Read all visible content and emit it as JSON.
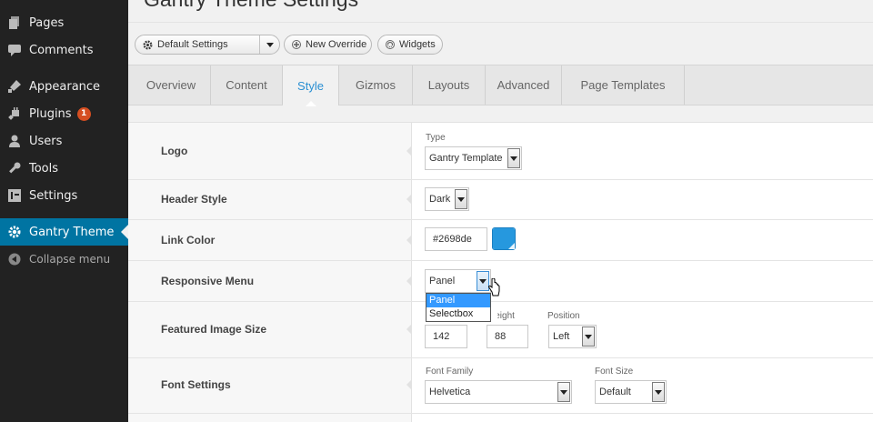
{
  "colors": {
    "sidebar_bg": "#222222",
    "active_bg": "#0074a2",
    "accent": "#2a8fd2",
    "swatch": "#2698de",
    "badge": "#d54e21"
  },
  "sidebar": {
    "items": [
      {
        "label": "Pages",
        "icon": "pages-icon"
      },
      {
        "label": "Comments",
        "icon": "comments-icon"
      },
      {
        "label": "Appearance",
        "icon": "appearance-icon"
      },
      {
        "label": "Plugins",
        "icon": "plugins-icon",
        "badge": "1"
      },
      {
        "label": "Users",
        "icon": "users-icon"
      },
      {
        "label": "Tools",
        "icon": "tools-icon"
      },
      {
        "label": "Settings",
        "icon": "settings-icon"
      },
      {
        "label": "Gantry Theme",
        "icon": "gear-icon",
        "active": true
      }
    ],
    "collapse_label": "Collapse menu"
  },
  "header": {
    "title": "Gantry Theme Settings"
  },
  "toolbar": {
    "default_label": "Default Settings",
    "override_label": "New Override",
    "widgets_label": "Widgets"
  },
  "tabs": [
    "Overview",
    "Content",
    "Style",
    "Gizmos",
    "Layouts",
    "Advanced",
    "Page Templates"
  ],
  "active_tab": "Style",
  "settings": {
    "logo": {
      "label": "Logo",
      "type_label": "Type",
      "type_value": "Gantry Template"
    },
    "header_style": {
      "label": "Header Style",
      "value": "Dark"
    },
    "link_color": {
      "label": "Link Color",
      "value": "#2698de"
    },
    "responsive_menu": {
      "label": "Responsive Menu",
      "value": "Panel",
      "options": [
        "Panel",
        "Selectbox"
      ]
    },
    "featured_image": {
      "label": "Featured Image Size",
      "height_label": "Height",
      "position_label": "Position",
      "width_value": "142",
      "height_value": "88",
      "position_value": "Left"
    },
    "font_settings": {
      "label": "Font Settings",
      "family_label": "Font Family",
      "family_value": "Helvetica",
      "size_label": "Font Size",
      "size_value": "Default"
    }
  }
}
